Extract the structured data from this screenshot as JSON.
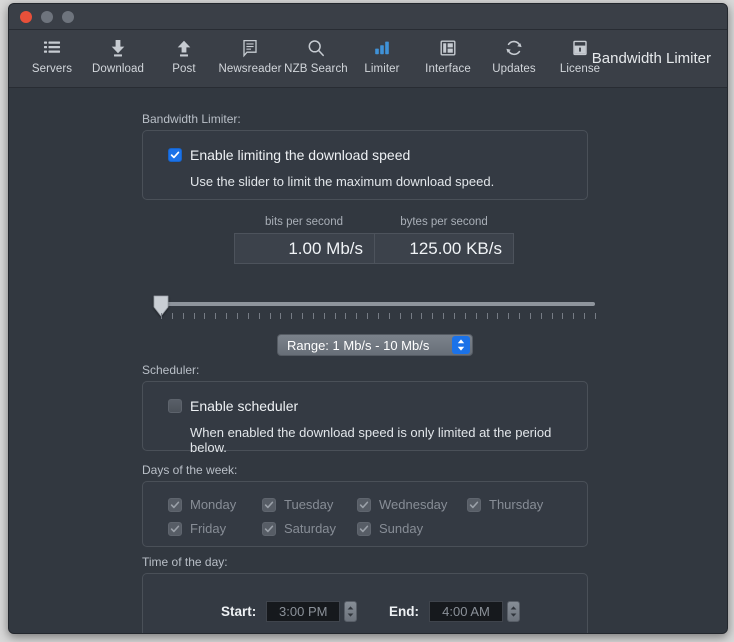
{
  "window": {
    "traffic_lights": [
      "close",
      "minimize",
      "zoom"
    ],
    "accent_color": "#1b72e8",
    "toolbar_title": "Bandwidth Limiter"
  },
  "toolbar": {
    "items": [
      {
        "label": "Servers",
        "icon": "servers-list-icon",
        "selected": false
      },
      {
        "label": "Download",
        "icon": "download-arrow-icon",
        "selected": false
      },
      {
        "label": "Post",
        "icon": "upload-arrow-icon",
        "selected": false
      },
      {
        "label": "Newsreader",
        "icon": "document-icon",
        "selected": false
      },
      {
        "label": "NZB Search",
        "icon": "magnifier-icon",
        "selected": false
      },
      {
        "label": "Limiter",
        "icon": "bar-chart-icon",
        "selected": true
      },
      {
        "label": "Interface",
        "icon": "window-panes-icon",
        "selected": false
      },
      {
        "label": "Updates",
        "icon": "refresh-icon",
        "selected": false
      },
      {
        "label": "License",
        "icon": "lock-icon",
        "selected": false
      }
    ]
  },
  "bandwidth_limiter": {
    "group_label": "Bandwidth Limiter:",
    "enable_checkbox": {
      "label": "Enable limiting the download speed",
      "checked": true
    },
    "help_text": "Use the slider to limit the maximum download speed."
  },
  "speed": {
    "bits_caption": "bits per second",
    "bits_value": "1.00 Mb/s",
    "bytes_caption": "bytes per second",
    "bytes_value": "125.00 KB/s"
  },
  "slider": {
    "position_percent": 0,
    "tick_count": 40
  },
  "range_popup": {
    "selected": "Range: 1 Mb/s - 10 Mb/s",
    "options": [
      "Range: 1 Mb/s - 10 Mb/s"
    ]
  },
  "scheduler": {
    "group_label": "Scheduler:",
    "enable_checkbox": {
      "label": "Enable scheduler",
      "checked": false
    },
    "help_text": "When enabled the download speed is only limited at the period below."
  },
  "days": {
    "group_label": "Days of the week:",
    "items": [
      {
        "label": "Monday",
        "checked": true,
        "enabled": false
      },
      {
        "label": "Tuesday",
        "checked": true,
        "enabled": false
      },
      {
        "label": "Wednesday",
        "checked": true,
        "enabled": false
      },
      {
        "label": "Thursday",
        "checked": true,
        "enabled": false
      },
      {
        "label": "Friday",
        "checked": true,
        "enabled": false
      },
      {
        "label": "Saturday",
        "checked": true,
        "enabled": false
      },
      {
        "label": "Sunday",
        "checked": true,
        "enabled": false
      }
    ]
  },
  "time_of_day": {
    "group_label": "Time of the day:",
    "start_label": "Start:",
    "start_value": "3:00 PM",
    "end_label": "End:",
    "end_value": "4:00 AM"
  }
}
